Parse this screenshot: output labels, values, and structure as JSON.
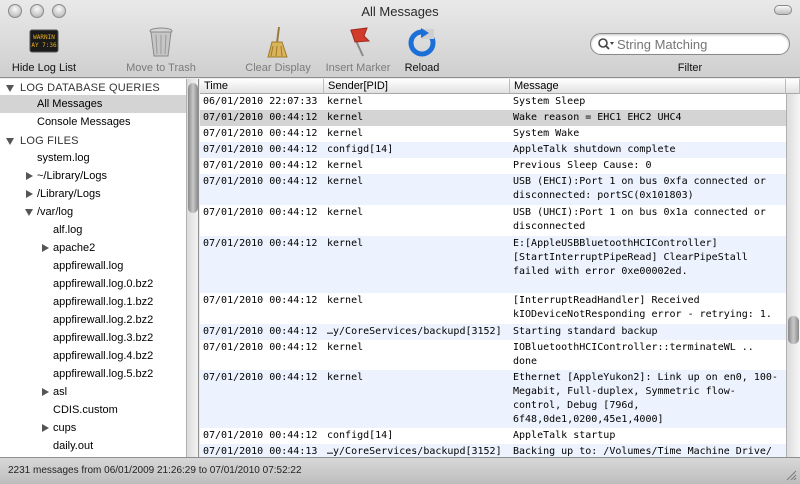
{
  "window": {
    "title": "All Messages"
  },
  "toolbar": {
    "hide_log_list": "Hide Log List",
    "move_to_trash": "Move to Trash",
    "clear_display": "Clear Display",
    "insert_marker": "Insert Marker",
    "reload": "Reload",
    "console_icon_text_1": "WARNIN",
    "console_icon_text_2": "AY 7:36",
    "search_placeholder": "String Matching",
    "filter_label": "Filter"
  },
  "sidebar": {
    "groups": [
      {
        "label": "LOG DATABASE QUERIES"
      },
      {
        "label": "LOG FILES"
      }
    ],
    "items": [
      {
        "label": "All Messages"
      },
      {
        "label": "Console Messages"
      },
      {
        "label": "system.log"
      },
      {
        "label": "~/Library/Logs"
      },
      {
        "label": "/Library/Logs"
      },
      {
        "label": "/var/log"
      },
      {
        "label": "alf.log"
      },
      {
        "label": "apache2"
      },
      {
        "label": "appfirewall.log"
      },
      {
        "label": "appfirewall.log.0.bz2"
      },
      {
        "label": "appfirewall.log.1.bz2"
      },
      {
        "label": "appfirewall.log.2.bz2"
      },
      {
        "label": "appfirewall.log.3.bz2"
      },
      {
        "label": "appfirewall.log.4.bz2"
      },
      {
        "label": "appfirewall.log.5.bz2"
      },
      {
        "label": "asl"
      },
      {
        "label": "CDIS.custom"
      },
      {
        "label": "cups"
      },
      {
        "label": "daily.out"
      }
    ]
  },
  "table": {
    "columns": [
      "Time",
      "Sender[PID]",
      "Message"
    ],
    "rows": [
      {
        "time": "06/01/2010 22:07:33",
        "sender": "kernel",
        "message": "System Sleep"
      },
      {
        "time": "07/01/2010 00:44:12",
        "sender": "kernel",
        "message": "Wake reason = EHC1 EHC2 UHC4"
      },
      {
        "time": "07/01/2010 00:44:12",
        "sender": "kernel",
        "message": "System Wake"
      },
      {
        "time": "07/01/2010 00:44:12",
        "sender": "configd[14]",
        "message": "AppleTalk shutdown complete"
      },
      {
        "time": "07/01/2010 00:44:12",
        "sender": "kernel",
        "message": "Previous Sleep Cause: 0"
      },
      {
        "time": "07/01/2010 00:44:12",
        "sender": "kernel",
        "message": "USB (EHCI):Port 1 on bus 0xfa connected or disconnected: portSC(0x101803)"
      },
      {
        "time": "07/01/2010 00:44:12",
        "sender": "kernel",
        "message": "USB (UHCI):Port 1 on bus 0x1a connected or disconnected"
      },
      {
        "time": "07/01/2010 00:44:12",
        "sender": "kernel",
        "message": "E:[AppleUSBBluetoothHCIController][StartInterruptPipeRead] ClearPipeStall failed with error 0xe00002ed."
      },
      {
        "time": "07/01/2010 00:44:12",
        "sender": "kernel",
        "message": "[InterruptReadHandler] Received kIODeviceNotResponding error - retrying: 1."
      },
      {
        "time": "07/01/2010 00:44:12",
        "sender": "…y/CoreServices/backupd[3152]",
        "message": "Starting standard backup"
      },
      {
        "time": "07/01/2010 00:44:12",
        "sender": "kernel",
        "message": "IOBluetoothHCIController::terminateWL .. done"
      },
      {
        "time": "07/01/2010 00:44:12",
        "sender": "kernel",
        "message": "Ethernet [AppleYukon2]: Link up on en0, 100-Megabit, Full-duplex, Symmetric flow-control, Debug [796d, 6f48,0de1,0200,45e1,4000]"
      },
      {
        "time": "07/01/2010 00:44:12",
        "sender": "configd[14]",
        "message": "AppleTalk startup"
      },
      {
        "time": "07/01/2010 00:44:13",
        "sender": "…y/CoreServices/backupd[3152]",
        "message": "Backing up to: /Volumes/Time Machine Drive/"
      }
    ]
  },
  "status": {
    "text": "2231 messages from 06/01/2009 21:26:29 to 07/01/2010 07:52:22"
  },
  "colors": {
    "selection": "#d4d4d4",
    "alt_row": "#edf3fe",
    "reload_blue": "#1b6fd6",
    "marker_red": "#d23a2a"
  }
}
